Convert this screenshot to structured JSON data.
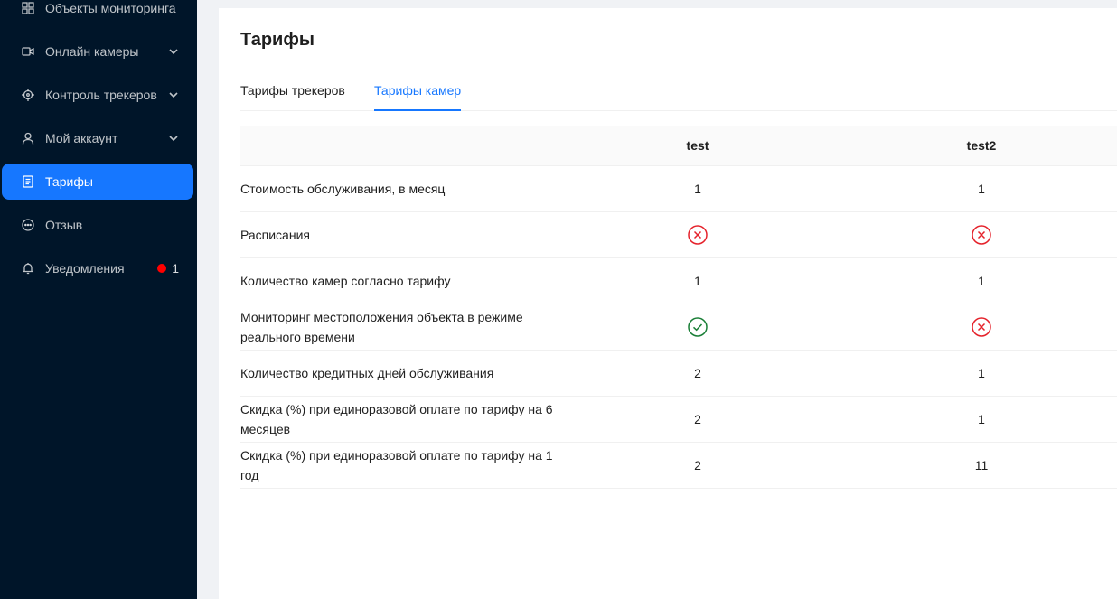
{
  "sidebar": {
    "items": [
      {
        "label": "Объекты мониторинга",
        "icon": "grid-icon"
      },
      {
        "label": "Онлайн камеры",
        "icon": "video-camera-icon",
        "expandable": true
      },
      {
        "label": "Контроль трекеров",
        "icon": "crosshair-icon",
        "expandable": true
      },
      {
        "label": "Мой аккаунт",
        "icon": "user-icon",
        "expandable": true
      },
      {
        "label": "Тарифы",
        "icon": "document-icon",
        "active": true
      },
      {
        "label": "Отзыв",
        "icon": "message-icon"
      },
      {
        "label": "Уведомления",
        "icon": "bell-icon",
        "badge": "1"
      }
    ],
    "colors": {
      "background": "#001529",
      "active": "#1677ff",
      "badge": "#ff0000"
    }
  },
  "main": {
    "title": "Тарифы",
    "tabs": [
      {
        "label": "Тарифы трекеров",
        "active": false
      },
      {
        "label": "Тарифы камер",
        "active": true
      }
    ],
    "table": {
      "columns": [
        "",
        "test",
        "test2"
      ],
      "rows": [
        {
          "label": "Стоимость обслуживания, в месяц",
          "test": "1",
          "test2": "1"
        },
        {
          "label": "Расписания",
          "test": "cross",
          "test2": "cross"
        },
        {
          "label": "Количество камер согласно тарифу",
          "test": "1",
          "test2": "1"
        },
        {
          "label": "Мониторинг местоположения объекта в режиме реального времени",
          "test": "check",
          "test2": "cross"
        },
        {
          "label": "Количество кредитных дней обслуживания",
          "test": "2",
          "test2": "1"
        },
        {
          "label": "Скидка (%) при единоразовой оплате по тарифу на 6 месяцев",
          "test": "2",
          "test2": "1"
        },
        {
          "label": "Скидка (%) при единоразовой оплате по тарифу на 1 год",
          "test": "2",
          "test2": "11"
        }
      ]
    },
    "colors": {
      "check": "#1a7f37",
      "cross": "#e5222b",
      "accent": "#1677ff"
    }
  }
}
